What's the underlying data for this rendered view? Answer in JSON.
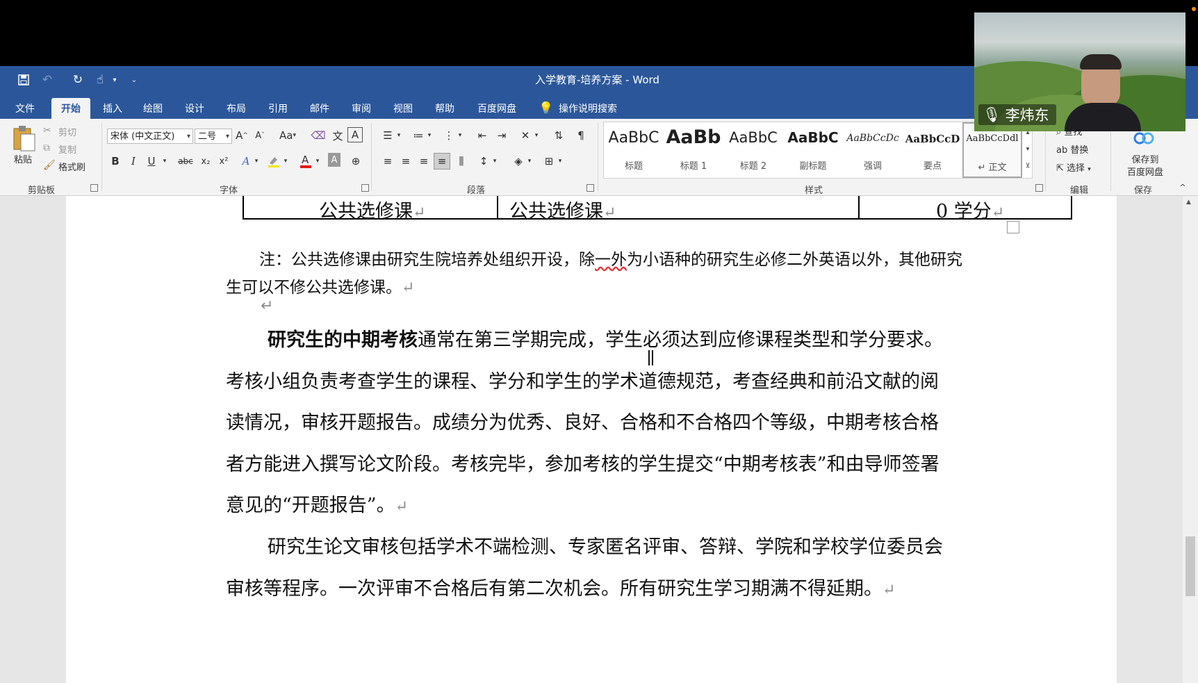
{
  "window": {
    "title": "入学教育-培养方案 - Word"
  },
  "tabs": [
    "文件",
    "开始",
    "插入",
    "绘图",
    "设计",
    "布局",
    "引用",
    "邮件",
    "审阅",
    "视图",
    "帮助",
    "百度网盘"
  ],
  "tell_me": "操作说明搜索",
  "clipboard": {
    "paste": "粘贴",
    "cut": "剪切",
    "copy": "复制",
    "format_painter": "格式刷",
    "label": "剪贴板"
  },
  "font": {
    "name": "宋体 (中文正文)",
    "size": "二号",
    "label": "字体",
    "buttons": {
      "bold": "B",
      "italic": "I",
      "underline": "U",
      "strike": "abc",
      "subscript": "x₂",
      "superscript": "x²",
      "case": "Aa",
      "grow": "A",
      "shrink": "A",
      "phonetic": "文",
      "border": "A",
      "shading": "A"
    }
  },
  "paragraph": {
    "label": "段落"
  },
  "styles": {
    "label": "样式",
    "items": [
      {
        "sample": "AaBbC",
        "name": "标题"
      },
      {
        "sample": "AaBb",
        "name": "标题 1"
      },
      {
        "sample": "AaBbC",
        "name": "标题 2"
      },
      {
        "sample": "AaBbC",
        "name": "副标题"
      },
      {
        "sample": "AaBbCcDc",
        "name": "强调"
      },
      {
        "sample": "AaBbCcD",
        "name": "要点"
      },
      {
        "sample": "AaBbCcDdl",
        "name": "↵ 正文"
      }
    ]
  },
  "editing": {
    "label": "编辑",
    "find": "查找",
    "replace": "替换",
    "select": "选择"
  },
  "save_group": {
    "label": "保存",
    "button": "保存到百度网盘",
    "line1": "保存到",
    "line2": "百度网盘"
  },
  "document": {
    "table_row": [
      "公共选修课",
      "公共选修课",
      "0 学分"
    ],
    "note": {
      "before": "注：公共选修课由研究生院培养处组织开设，除",
      "squiggle": "一外",
      "after": "为小语种的研究生必修二外英语以外，其他研究生可以不修公共选修课。"
    },
    "para1_bold": "研究生的中期考核",
    "para1_rest": "通常在第三学期完成，学生必须达到应修课程类型和学分要求。考核小组负责考查学生的课程、学分和学生的学术道德规范，考查经典和前沿文献的阅读情况，审核开题报告。成绩分为优秀、良好、合格和不合格四个等级，中期考核合格者方能进入撰写论文阶段。考核完毕，参加考核的学生提交“中期考核表”和由导师签署意见的“开题报告”。",
    "para2": "研究生论文审核包括学术不端检测、专家匿名评审、答辩、学院和学校学位委员会审核等程序。一次评审不合格后有第二次机会。所有研究生学习期满不得延期。",
    "return_mark": "↵"
  },
  "webcam": {
    "speaker": "李炜东"
  },
  "colors": {
    "word_blue": "#2b579a",
    "ribbon_bg": "#f3f3f3"
  }
}
